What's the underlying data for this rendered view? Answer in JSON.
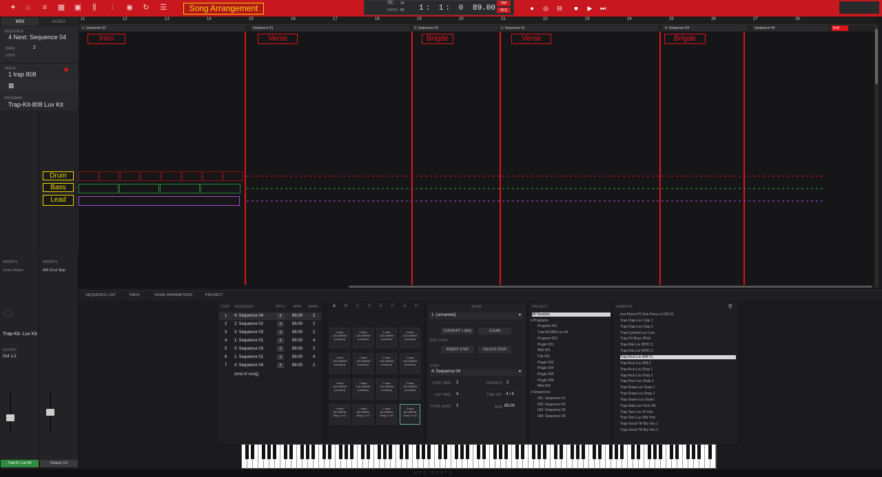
{
  "annotation_title": "Song Arrangement",
  "transport": {
    "tc_label": "TC",
    "tc_value": "16",
    "swing_label": "SWING",
    "swing_value": "50",
    "position": "1: 1: 0",
    "tempo": "89.00",
    "tap_label": "TAP",
    "seq_label": "SEQ"
  },
  "left_panel": {
    "tab_midi": "MIDI",
    "tab_audio": "AUDIO",
    "sequence_label": "SEQUENCE",
    "sequence_value": "4 Next: Sequence 04",
    "bars_label": "Bars",
    "bars_value": "2",
    "loop_label": "Loop",
    "track_label": "TRACK",
    "track_value": "1 trap 808",
    "program_label": "PROGRAM",
    "program_value": "Trap-Kit-808 Luv Kit",
    "inserts_label_1": "INSERTS",
    "inserts_value_1": "Comp Master",
    "inserts_label_2": "INSERTS",
    "inserts_value_2": "AIR Ch.el Strip",
    "strip_program": "Trap-Kit. Luv Kit",
    "output_label": "OUTPUT",
    "output_value": "Out 1,2",
    "strip_name_1": "Trap-Ki. Luv Kit",
    "strip_name_2": "Outputs 1/2"
  },
  "ruler": [
    "11",
    "12",
    "13",
    "14",
    "15",
    "16",
    "17",
    "18",
    "19",
    "20",
    "21",
    "22",
    "23",
    "24",
    "25",
    "26",
    "27",
    "28"
  ],
  "sequence_lane": [
    {
      "label": "1: Sequence 01"
    },
    {
      "label": "Sequence 01"
    },
    {
      "label": "3: Sequence 03"
    },
    {
      "label": "1: Sequence 01"
    },
    {
      "label": "4: Sequence 04"
    },
    {
      "label": "Sequence 04"
    }
  ],
  "end_label": "End",
  "sections": [
    {
      "label": "Intro"
    },
    {
      "label": "Verse"
    },
    {
      "label": "Brigde"
    },
    {
      "label": "Verse"
    },
    {
      "label": "Brigde"
    }
  ],
  "track_labels": [
    "Drum",
    "Bass",
    "Lead"
  ],
  "bottom_tabs": [
    "SEQUENCE LIST",
    "PADS",
    "SONG PARAMETERS",
    "PROJECT"
  ],
  "step_table": {
    "headers": [
      "STEP",
      "SEQUENCE",
      "RPTS",
      "BPM",
      "BARS"
    ],
    "rows": [
      {
        "step": "1",
        "sequence": "4: Sequence 04",
        "rpts": "2",
        "bpm": "89.00",
        "bars": "2"
      },
      {
        "step": "2",
        "sequence": "2: Sequence 02",
        "rpts": "2",
        "bpm": "89.00",
        "bars": "2"
      },
      {
        "step": "3",
        "sequence": "3: Sequence 03",
        "rpts": "1",
        "bpm": "89.00",
        "bars": "2"
      },
      {
        "step": "4",
        "sequence": "1: Sequence 01",
        "rpts": "2",
        "bpm": "89.00",
        "bars": "4"
      },
      {
        "step": "5",
        "sequence": "3: Sequence 03",
        "rpts": "1",
        "bpm": "89.00",
        "bars": "2"
      },
      {
        "step": "6",
        "sequence": "1: Sequence 01",
        "rpts": "1",
        "bpm": "89.00",
        "bars": "4"
      },
      {
        "step": "7",
        "sequence": "4: Sequence 04",
        "rpts": "2",
        "bpm": "89.00",
        "bars": "2"
      }
    ],
    "end_text": "(end of song)"
  },
  "pad_letters": [
    "A",
    "B",
    "C",
    "D",
    "E",
    "F",
    "G",
    "H"
  ],
  "pads": [
    "2 bars 120.00BPM (unused)",
    "2 bars 120.00BPM (unused)",
    "2 bars 120.00BPM (unused)",
    "2 bars 120.00BPM (unused)",
    "2 bars 120.00BPM (unused)",
    "2 bars 120.00BPM (unused)",
    "2 bars 120.00BPM (unused)",
    "2 bars 120.00BPM (unused)",
    "2 bars 120.00BPM (unused)",
    "2 bars 120.00BPM (unused)",
    "2 bars 120.00BPM (unused)",
    "2 bars 120.00BPM (unused)",
    "4 bars 89.00BPM Sequ..e 01",
    "2 bars 89.00BPM Sequ..e 02",
    "2 bars 89.00BPM Sequ..e 03",
    "2 bars 89.00BPM Sequ..e 04"
  ],
  "song_panel": {
    "header": "SONG",
    "song_value": "1: (unnamed)",
    "convert_label": "CONVERT > SEQ",
    "clear_label": "CLEAR",
    "edit_step_label": "EDIT STEP",
    "insert_label": "INSERT STEP",
    "delete_label": "DELETE STEP",
    "step_label": "STEP",
    "step_value": "4: Sequence 04",
    "first_bar_label": "FIRST BAR",
    "first_bar_value": "1",
    "repeats_label": "REPEATS",
    "repeats_value": "2",
    "last_bar_label": "LAST BAR",
    "last_bar_value": "4",
    "time_sig_label": "TIME SIG",
    "time_sig_value": "4 / 4",
    "total_bars_label": "TOTAL BARS",
    "total_bars_value": "2",
    "bpm_label": "BPM",
    "bpm_value": "89.00"
  },
  "project": {
    "header": "PROJECT",
    "items": [
      "All Samples",
      "▾ Programs",
      "Program 001",
      "Trap-Kit-808 Luv Kit",
      "Program 002",
      "Plugin 001",
      "Midi 001",
      "Clip 001",
      "Plugin 002",
      "Plugin 004",
      "Plugin 005",
      "Plugin 006",
      "Midi 002",
      "▾ Sequences",
      "001: Sequence 01",
      "002: Sequence 02",
      "003: Sequence 03",
      "004: Sequence 04"
    ]
  },
  "samples": {
    "header": "SAMPLES",
    "items": [
      "Inst-Piano-F9 Club Piano X-038 01",
      "Trap-Clap-Luv Clap 1",
      "Trap-Clap-Luv Clap 2",
      "Trap-Cymbal-Luv Cym",
      "Trap-FX-Buss 2Roll",
      "Trap-Hat-Luv HiHCl 1",
      "Trap-Hat-Luv HiHCl 2",
      "Trap-Kick-Luv 808 01",
      "Trap-Kick-Luv 808 2",
      "Trap-Kick-Luv Drop 1",
      "Trap-Kick-Luv Drop 2",
      "Trap-Perc-Luv Shak 2",
      "Trap-Snap-Luv Snap 1",
      "Trap-Snap-Luv Snap 2",
      "Trap-Snare-Luv Snare",
      "Trap-Stab-Luv Orch Hit",
      "Trap-Tom-Luv Hi Tom",
      "Trap-Tom-Luv Mid Tom",
      "Trap-Vocal-TR Bry Vox 1",
      "Trap-Vocal-TR Bry Vox 2"
    ]
  },
  "footer_brand": "MPC BEATS",
  "colors": {
    "accent_red": "#e0141b",
    "annotation_yellow": "#f0d600",
    "loop_blue": "#1aa6e6"
  }
}
